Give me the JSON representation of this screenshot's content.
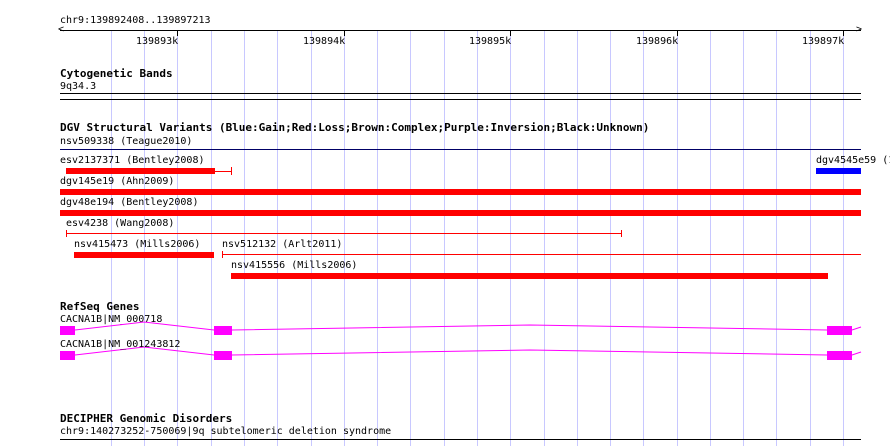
{
  "location": "chr9:139892408..139897213",
  "ruler": {
    "ticks": [
      {
        "label": "139893k"
      },
      {
        "label": "139894k"
      },
      {
        "label": "139895k"
      },
      {
        "label": "139896k"
      },
      {
        "label": "139897k"
      }
    ]
  },
  "tracks": {
    "cytoband": {
      "title": "Cytogenetic Bands",
      "band_label": "9q34.3"
    },
    "dgv": {
      "title": "DGV Structural Variants (Blue:Gain;Red:Loss;Brown:Complex;Purple:Inversion;Black:Unknown)",
      "features": [
        {
          "label": "nsv509338 (Teague2010)"
        },
        {
          "label": "esv2137371 (Bentley2008)"
        },
        {
          "label": "dgv4545e59 (1"
        },
        {
          "label": "dgv145e19 (Ahn2009)"
        },
        {
          "label": "dgv48e194 (Bentley2008)"
        },
        {
          "label": "esv4238 (Wang2008)"
        },
        {
          "label": "nsv415473 (Mills2006)"
        },
        {
          "label": "nsv512132 (Arlt2011)"
        },
        {
          "label": "nsv415556 (Mills2006)"
        }
      ]
    },
    "refseq": {
      "title": "RefSeq Genes",
      "transcripts": [
        {
          "label": "CACNA1B|NM_000718"
        },
        {
          "label": "CACNA1B|NM_001243812"
        }
      ]
    },
    "decipher": {
      "title": "DECIPHER Genomic Disorders",
      "features": [
        {
          "label": "chr9:140273252-750069|9q subtelomeric deletion syndrome"
        }
      ]
    }
  },
  "colors": {
    "gain": "#0000ff",
    "loss": "#ff0000",
    "gene": "#ff00ff",
    "grid": "#c8c8ff",
    "line": "#000066"
  }
}
